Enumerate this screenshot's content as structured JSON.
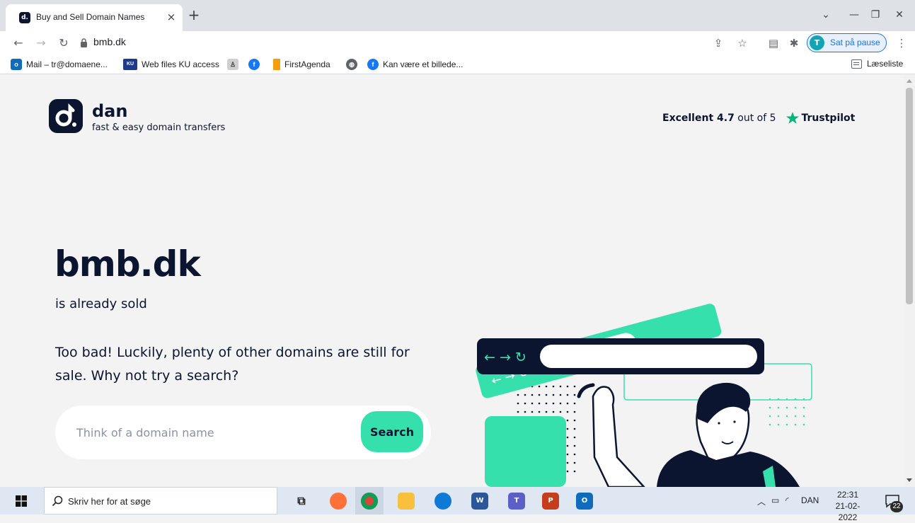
{
  "browser": {
    "tab_title": "Buy and Sell Domain Names",
    "tab_close": "×",
    "new_tab": "+",
    "url": "bmb.dk",
    "profile_initial": "T",
    "profile_label": "Sat på pause"
  },
  "bookmarks": {
    "items": [
      {
        "label": "Mail – tr@domaene..."
      },
      {
        "label": "Web files KU access"
      },
      {
        "label": "FirstAgenda"
      },
      {
        "label": "Kan være et billede..."
      }
    ],
    "reading_list": "Læseliste"
  },
  "header": {
    "logo_name": "dan",
    "logo_tagline": "fast & easy domain transfers",
    "trust_label": "Excellent 4.7",
    "trust_suffix": " out of 5",
    "trust_brand": "Trustpilot"
  },
  "hero": {
    "domain": "bmb.dk",
    "status": "is already sold",
    "description": "Too bad! Luckily, plenty of other domains are still for sale. Why not try a search?",
    "search_placeholder": "Think of a domain name",
    "search_button": "Search"
  },
  "illustration": {
    "nav_glyphs": "← → ↻"
  },
  "colors": {
    "navy": "#0c1530",
    "mint": "#35e0ad",
    "page_bg": "#f3f3f4"
  },
  "taskbar": {
    "search_text": "Skriv her for at søge",
    "language": "DAN",
    "time": "22:31",
    "date": "21-02-2022",
    "notification_count": "22"
  }
}
